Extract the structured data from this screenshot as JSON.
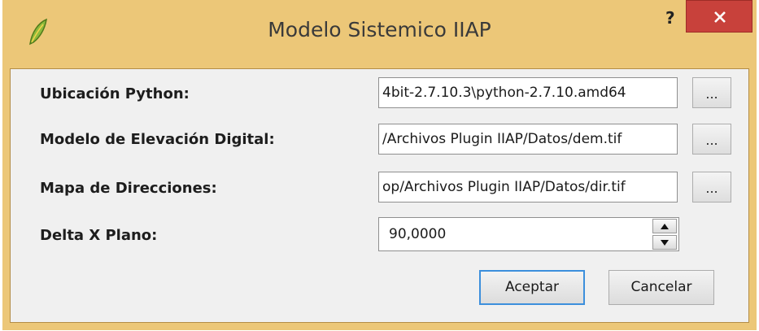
{
  "window": {
    "title": "Modelo Sistemico IIAP",
    "help_label": "?",
    "app_icon": "qgis-leaf-icon",
    "close_icon": "close-icon",
    "accent_close": "#c8413b",
    "frame_color": "#ecc778"
  },
  "form": {
    "python": {
      "label": "Ubicación Python:",
      "value": "4bit-2.7.10.3\\python-2.7.10.amd64",
      "browse_label": "..."
    },
    "dem": {
      "label": "Modelo de Elevación Digital:",
      "value": "/Archivos Plugin IIAP/Datos/dem.tif",
      "browse_label": "..."
    },
    "dir": {
      "label": "Mapa de Direcciones:",
      "value": "op/Archivos Plugin IIAP/Datos/dir.tif",
      "browse_label": "..."
    },
    "delta": {
      "label": "Delta X Plano:",
      "value": "90,0000"
    }
  },
  "buttons": {
    "accept": "Aceptar",
    "cancel": "Cancelar"
  }
}
